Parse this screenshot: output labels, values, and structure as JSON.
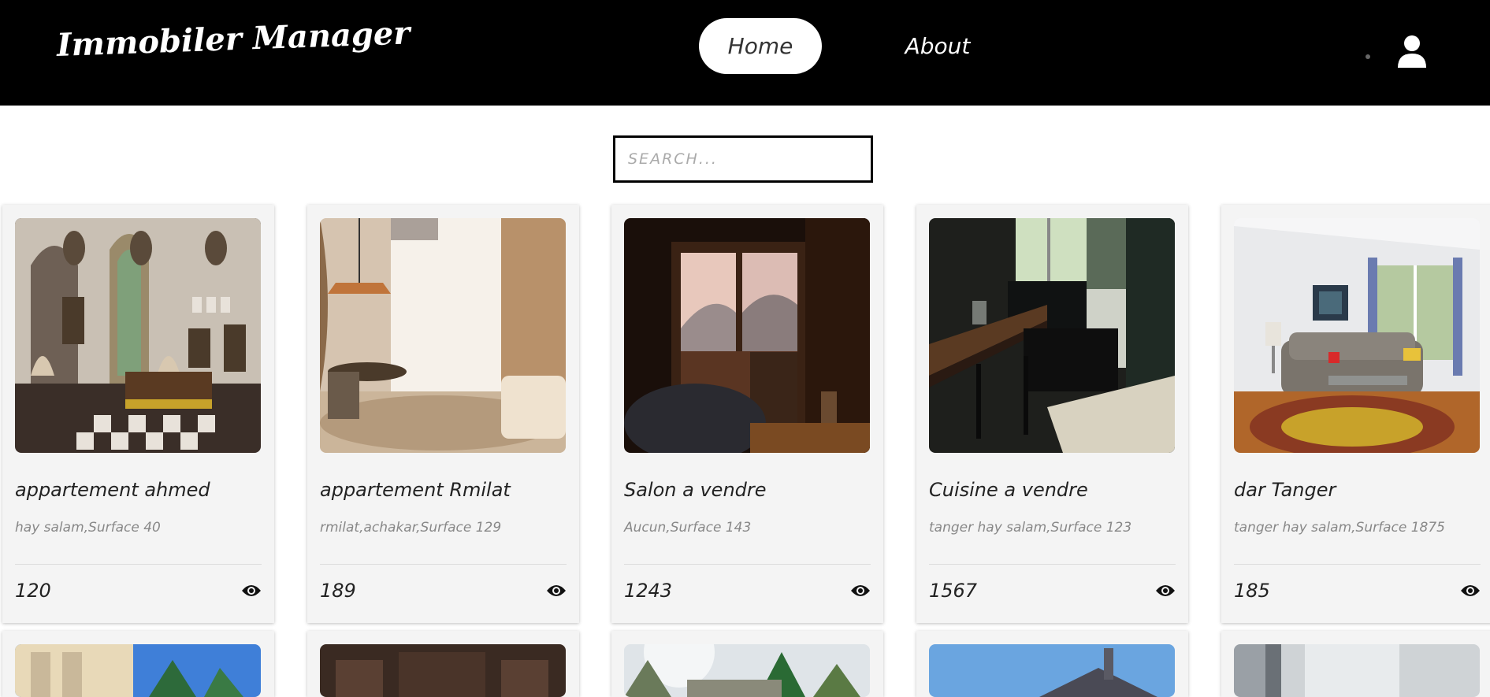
{
  "header": {
    "logo": "Immobiler Manager",
    "nav": [
      {
        "label": "Home"
      },
      {
        "label": "About"
      }
    ]
  },
  "search": {
    "placeholder": "SEARCH..."
  },
  "listings": [
    {
      "title": "appartement ahmed",
      "description": "hay salam,Surface 40",
      "price": "120"
    },
    {
      "title": "appartement Rmilat",
      "description": "rmilat,achakar,Surface 129",
      "price": "189"
    },
    {
      "title": "Salon a vendre",
      "description": "Aucun,Surface 143",
      "price": "1243"
    },
    {
      "title": "Cuisine a vendre",
      "description": "tanger hay salam,Surface 123",
      "price": "1567"
    },
    {
      "title": "dar Tanger",
      "description": "tanger hay salam,Surface 1875",
      "price": "185"
    }
  ],
  "colors": {
    "navbar": "#000000",
    "card_background": "#f4f4f4",
    "text": "#222222",
    "muted_text": "#888888"
  }
}
